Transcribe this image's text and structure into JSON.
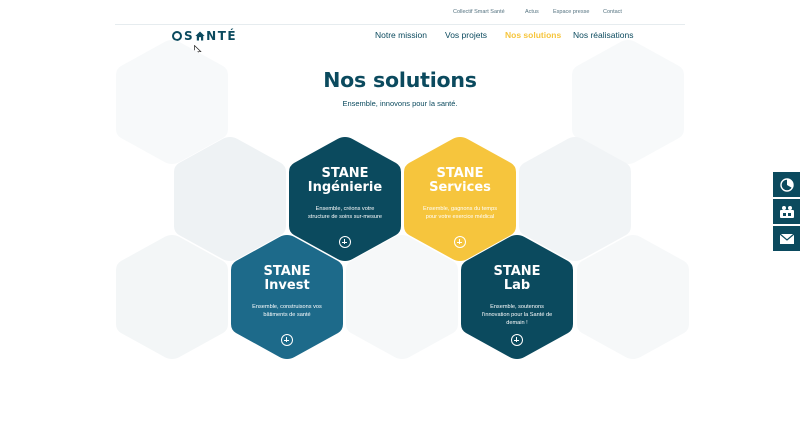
{
  "topbar": {
    "links": [
      {
        "label": "Collectif Smart Santé"
      },
      {
        "label": "Actus"
      },
      {
        "label": "Espace presse"
      },
      {
        "label": "Contact"
      }
    ]
  },
  "logo": {
    "text": "S NTÉ"
  },
  "nav": {
    "items": [
      {
        "label": "Notre mission"
      },
      {
        "label": "Vos projets"
      },
      {
        "label": "Nos solutions"
      },
      {
        "label": "Nos réalisations"
      }
    ],
    "active_index": 2
  },
  "hero": {
    "title": "Nos solutions",
    "subtitle": "Ensemble, innovons pour la santé."
  },
  "solutions": [
    {
      "line1": "STANE",
      "line2": "Ingénierie",
      "desc": "Ensemble, créons votre structure de soins sur-mesure",
      "color": "#0b4a5e"
    },
    {
      "line1": "STANE",
      "line2": "Services",
      "desc": "Ensemble, gagnons du temps pour votre exercice médical",
      "color": "#f6c53d"
    },
    {
      "line1": "STANE",
      "line2": "Invest",
      "desc": "Ensemble, construisons vos bâtiments de santé",
      "color": "#1d6a8a"
    },
    {
      "line1": "STANE",
      "line2": "Lab",
      "desc": "Ensemble, soutenons l'innovation pour la Santé de demain !",
      "color": "#0b4a5e"
    }
  ],
  "colors": {
    "primary": "#0b4a5e",
    "accent": "#f6c53d",
    "ghost_hex": "#f0f3f5"
  },
  "side_tabs": [
    {
      "icon": "chart-icon"
    },
    {
      "icon": "team-icon"
    },
    {
      "icon": "mail-icon"
    }
  ]
}
